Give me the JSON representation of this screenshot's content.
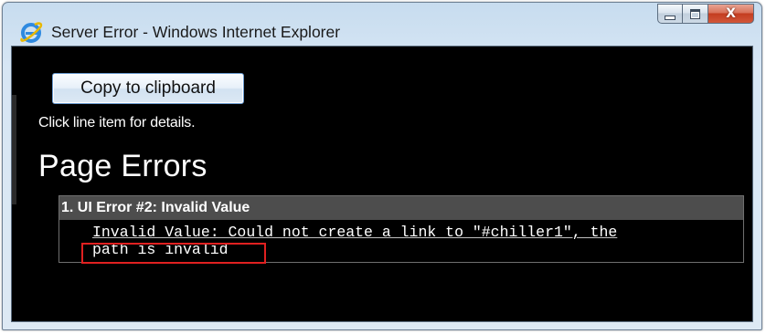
{
  "window": {
    "title": "Server Error - Windows Internet Explorer",
    "icon": "internet-explorer-icon",
    "controls": {
      "minimize_icon": "minimize-icon",
      "maximize_icon": "maximize-icon",
      "close_glyph": "X"
    }
  },
  "page": {
    "copy_button_label": "Copy to clipboard",
    "hint": "Click line item for details.",
    "heading": "Page Errors",
    "errors": [
      {
        "header": "1. UI Error #2: Invalid Value",
        "message_line1": "Invalid Value: Could not create a link to \"#chiller1\", the",
        "message_line2": "path is invalid"
      }
    ]
  },
  "colors": {
    "background": "#000000",
    "error_header_bg": "#4d4d4d",
    "highlight": "#e02020",
    "text": "#ffffff"
  }
}
